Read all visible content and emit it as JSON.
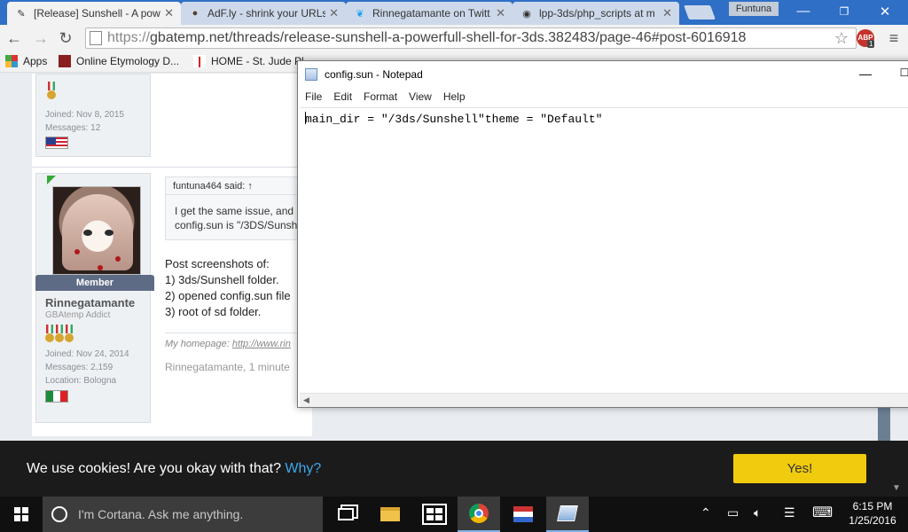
{
  "browser": {
    "tabs": [
      {
        "title": "[Release] Sunshell - A pow",
        "icon": "gbatemp-icon"
      },
      {
        "title": "AdF.ly - shrink your URLs",
        "icon": "adfly-icon"
      },
      {
        "title": "Rinnegatamante on Twitt",
        "icon": "twitter-icon"
      },
      {
        "title": "lpp-3ds/php_scripts at m",
        "icon": "github-icon"
      }
    ],
    "profile_name": "Funtuna",
    "url_proto": "https://",
    "url_rest": "gbatemp.net/threads/release-sunshell-a-powerfull-shell-for-3ds.382483/page-46#post-6016918",
    "abp_label": "ABP",
    "abp_count": "1",
    "bookmarks": [
      {
        "label": "Apps"
      },
      {
        "label": "Online Etymology D..."
      },
      {
        "label": "HOME - St. Jude Pl"
      }
    ]
  },
  "post_prev": {
    "joined": "Joined: Nov 8, 2015",
    "messages": "Messages: 12"
  },
  "post": {
    "badge": "Member",
    "username": "Rinnegatamante",
    "usertitle": "GBAtemp Addict",
    "joined": "Joined: Nov 24, 2014",
    "messages": "Messages: 2,159",
    "location": "Location: Bologna",
    "quote_author": "funtuna464 said: ↑",
    "quote_line1": "I get the same issue, and",
    "quote_line2": "config.sun is \"/3DS/Sunsh",
    "text_lines": [
      "Post screenshots of:",
      "1) 3ds/Sunshell folder.",
      "2) opened config.sun file",
      "3) root of sd folder."
    ],
    "homepage_label": "My homepage: ",
    "homepage_link": "http://www.rin",
    "meta": "Rinnegatamante, 1 minute"
  },
  "notepad": {
    "title": "config.sun - Notepad",
    "menu": [
      "File",
      "Edit",
      "Format",
      "View",
      "Help"
    ],
    "content": "main_dir = \"/3ds/Sunshell\"theme = \"Default\""
  },
  "cookie": {
    "text": "We use cookies! Are you okay with that?",
    "link": "Why?",
    "button": "Yes!"
  },
  "taskbar": {
    "cortana_placeholder": "I'm Cortana. Ask me anything.",
    "time": "6:15 PM",
    "date": "1/25/2016"
  }
}
